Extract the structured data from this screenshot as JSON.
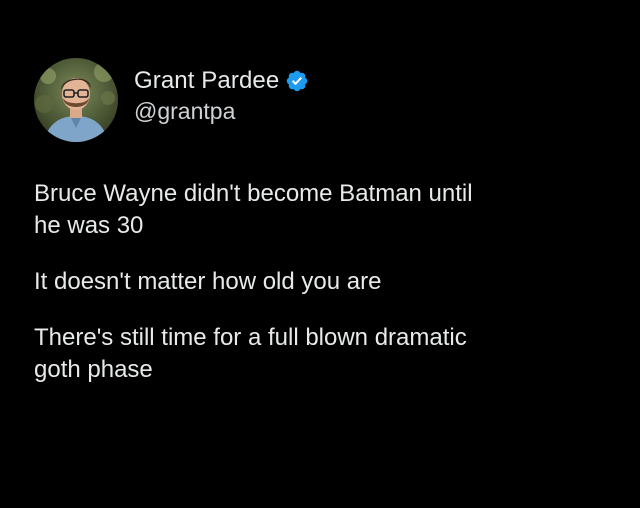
{
  "tweet": {
    "author": {
      "display_name": "Grant Pardee",
      "handle": "@grantpa",
      "verified": true
    },
    "paragraphs": [
      "Bruce Wayne didn't become Batman until\nhe was 30",
      "It doesn't matter how old you are",
      "There's still time for a full blown dramatic\ngoth phase"
    ]
  },
  "colors": {
    "background": "#000000",
    "text": "#e7e9ea",
    "verified_badge": "#1d9bf0"
  },
  "icons": {
    "verified": "verified-badge-icon"
  }
}
